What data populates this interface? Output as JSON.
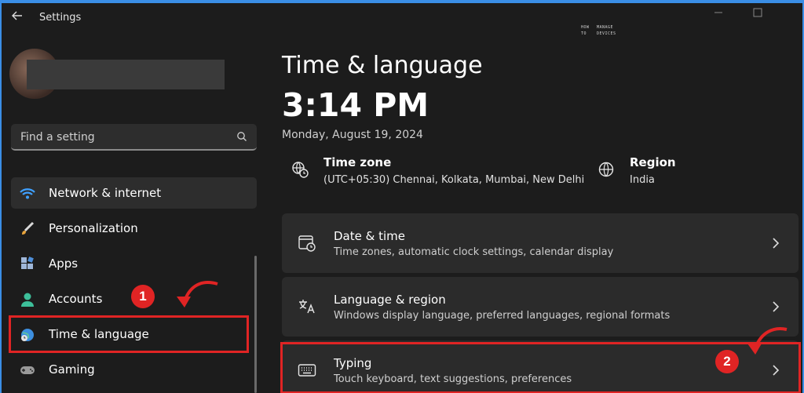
{
  "window": {
    "title": "Settings",
    "back_icon": "arrow-left-icon",
    "controls": [
      "minimize",
      "maximize"
    ]
  },
  "watermark": {
    "line1": "HOW",
    "line1b": "MANAGE",
    "line2": "TO",
    "line2b": "DEVICES"
  },
  "sidebar": {
    "search_placeholder": "Find a setting",
    "items": [
      {
        "label": "Network & internet",
        "icon": "wifi-icon",
        "active": false
      },
      {
        "label": "Personalization",
        "icon": "brush-icon",
        "active": false
      },
      {
        "label": "Apps",
        "icon": "apps-icon",
        "active": false
      },
      {
        "label": "Accounts",
        "icon": "person-icon",
        "active": false
      },
      {
        "label": "Time & language",
        "icon": "globe-clock-icon",
        "active": true
      },
      {
        "label": "Gaming",
        "icon": "gamepad-icon",
        "active": false
      }
    ]
  },
  "main": {
    "title": "Time & language",
    "time": "3:14 PM",
    "date": "Monday, August 19, 2024",
    "time_zone": {
      "title": "Time zone",
      "value": "(UTC+05:30) Chennai, Kolkata, Mumbai, New Delhi"
    },
    "region": {
      "title": "Region",
      "value": "India"
    },
    "cards": [
      {
        "title": "Date & time",
        "subtitle": "Time zones, automatic clock settings, calendar display",
        "icon": "calendar-clock-icon"
      },
      {
        "title": "Language & region",
        "subtitle": "Windows display language, preferred languages, regional formats",
        "icon": "language-icon"
      },
      {
        "title": "Typing",
        "subtitle": "Touch keyboard, text suggestions, preferences",
        "icon": "keyboard-icon"
      }
    ]
  },
  "annotations": {
    "badge1": "1",
    "badge2": "2",
    "color": "#e02424"
  }
}
